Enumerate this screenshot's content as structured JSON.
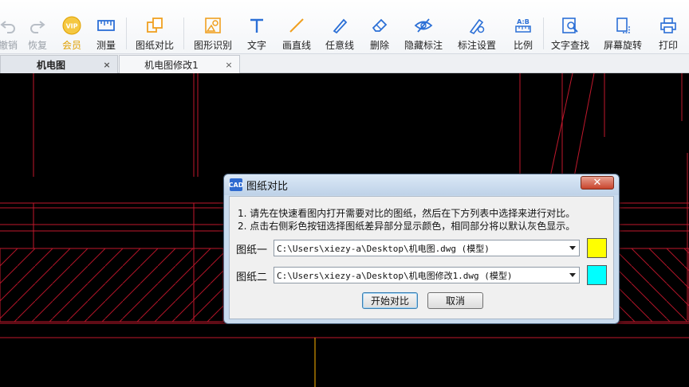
{
  "toolbar": {
    "buttons": [
      {
        "label": "撤销",
        "icon": "undo-icon",
        "disabled": true
      },
      {
        "label": "恢复",
        "icon": "redo-icon",
        "disabled": true
      },
      {
        "label": "会员",
        "icon": "vip-icon",
        "badge": "VIP"
      },
      {
        "label": "测量",
        "icon": "measure-icon"
      },
      {
        "label": "图纸对比",
        "icon": "compare-drawings-icon"
      },
      {
        "label": "图形识别",
        "icon": "shape-recognition-icon"
      },
      {
        "label": "文字",
        "icon": "text-icon"
      },
      {
        "label": "画直线",
        "icon": "line-icon"
      },
      {
        "label": "任意线",
        "icon": "freehand-line-icon"
      },
      {
        "label": "删除",
        "icon": "eraser-icon"
      },
      {
        "label": "隐藏标注",
        "icon": "hide-annotation-icon"
      },
      {
        "label": "标注设置",
        "icon": "annotation-settings-icon"
      },
      {
        "label": "比例",
        "icon": "scale-icon",
        "badge": "A:B"
      },
      {
        "label": "文字查找",
        "icon": "text-search-icon"
      },
      {
        "label": "屏幕旋转",
        "icon": "screen-rotate-icon"
      },
      {
        "label": "打印",
        "icon": "print-icon"
      }
    ],
    "accent": "#2b6fd6"
  },
  "tabs": [
    {
      "label": "机电图",
      "active": true,
      "close": "×"
    },
    {
      "label": "机电图修改1",
      "active": false,
      "close": "×"
    }
  ],
  "dialog": {
    "title": "图纸对比",
    "icon_text": "CAD",
    "close": "✕",
    "instruction1": "1. 请先在快速看图内打开需要对比的图纸，然后在下方列表中选择来进行对比。",
    "instruction2": "2. 点击右侧彩色按钮选择图纸差异部分显示颜色，相同部分将以默认灰色显示。",
    "rows": [
      {
        "label": "图纸一",
        "value": "C:\\Users\\xiezy-a\\Desktop\\机电图.dwg (模型)",
        "color": "#ffff00"
      },
      {
        "label": "图纸二",
        "value": "C:\\Users\\xiezy-a\\Desktop\\机电图修改1.dwg (模型)",
        "color": "#00ffff"
      }
    ],
    "start_label": "开始对比",
    "cancel_label": "取消"
  },
  "colors": {
    "cad_line": "#c0182c",
    "cad_line_yellow": "#ffb400",
    "canvas_bg": "#000000"
  }
}
